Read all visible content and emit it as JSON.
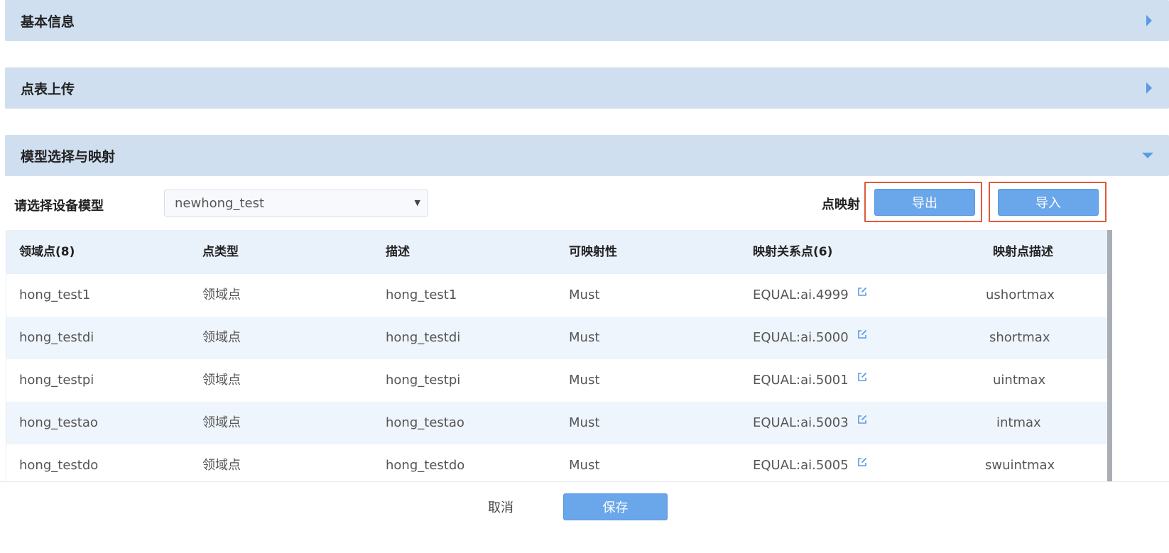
{
  "panels": {
    "basic_info": "基本信息",
    "point_upload": "点表上传",
    "model_mapping": "模型选择与映射"
  },
  "model_select": {
    "label": "请选择设备模型",
    "value": "newhong_test"
  },
  "point_mapping": {
    "label": "点映射",
    "export_label": "导出",
    "import_label": "导入"
  },
  "table": {
    "headers": [
      "领域点(8)",
      "点类型",
      "描述",
      "可映射性",
      "映射关系点(6)",
      "映射点描述"
    ],
    "rows": [
      [
        "hong_test1",
        "领域点",
        "hong_test1",
        "Must",
        "EQUAL:ai.4999",
        "ushortmax"
      ],
      [
        "hong_testdi",
        "领域点",
        "hong_testdi",
        "Must",
        "EQUAL:ai.5000",
        "shortmax"
      ],
      [
        "hong_testpi",
        "领域点",
        "hong_testpi",
        "Must",
        "EQUAL:ai.5001",
        "uintmax"
      ],
      [
        "hong_testao",
        "领域点",
        "hong_testao",
        "Must",
        "EQUAL:ai.5003",
        "intmax"
      ],
      [
        "hong_testdo",
        "领域点",
        "hong_testdo",
        "Must",
        "EQUAL:ai.5005",
        "swuintmax"
      ]
    ]
  },
  "footer": {
    "cancel_label": "取消",
    "save_label": "保存"
  },
  "colors": {
    "panel_header_bg": "#cfdff0",
    "accent": "#6aa6ea",
    "highlight": "#e05a3b",
    "row_alt": "#eff5fc"
  },
  "icons": {
    "collapsed": "caret-right-icon",
    "expanded": "caret-down-icon",
    "edit": "edit-icon"
  }
}
